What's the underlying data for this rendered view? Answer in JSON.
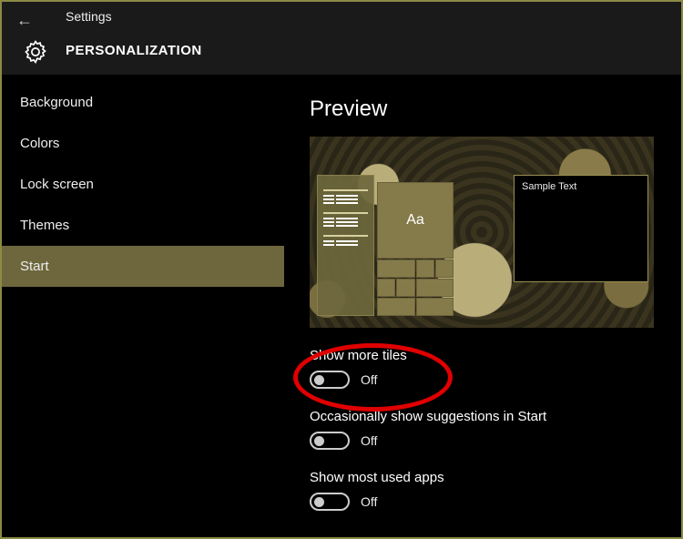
{
  "header": {
    "app": "Settings",
    "category": "PERSONALIZATION"
  },
  "sidebar": {
    "items": [
      {
        "label": "Background",
        "active": false
      },
      {
        "label": "Colors",
        "active": false
      },
      {
        "label": "Lock screen",
        "active": false
      },
      {
        "label": "Themes",
        "active": false
      },
      {
        "label": "Start",
        "active": true
      }
    ]
  },
  "content": {
    "preview_heading": "Preview",
    "tile_text": "Aa",
    "sample_window": "Sample Text",
    "settings": [
      {
        "label": "Show more tiles",
        "state": "Off"
      },
      {
        "label": "Occasionally show suggestions in Start",
        "state": "Off"
      },
      {
        "label": "Show most used apps",
        "state": "Off"
      }
    ]
  }
}
